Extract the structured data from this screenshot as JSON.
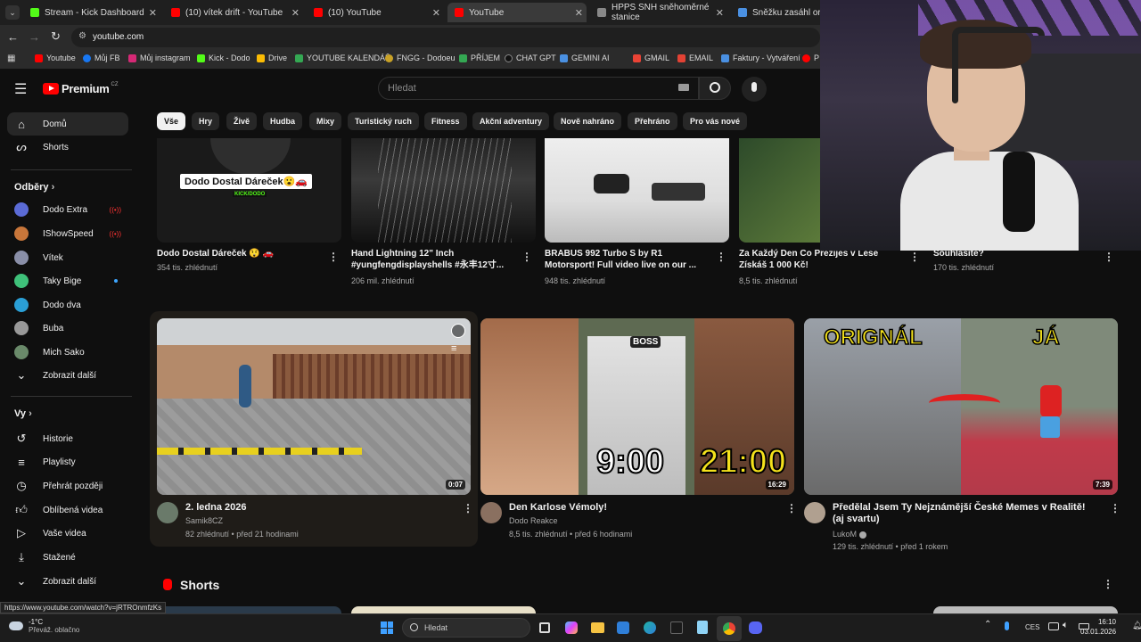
{
  "browser": {
    "tabs": [
      {
        "label": "Stream - Kick Dashboard",
        "color": "#53fc18"
      },
      {
        "label": "(10) vítek drift - YouTube",
        "color": "#ff0000"
      },
      {
        "label": "(10) YouTube",
        "color": "#ff0000"
      },
      {
        "label": "YouTube",
        "color": "#ff0000"
      },
      {
        "label": "HPPS SNH sněhoměrné stanice",
        "color": "#888888"
      },
      {
        "label": "Sněžku zasáhl orkán, vi",
        "color": "#4a90e2"
      }
    ],
    "url": "youtube.com",
    "bookmarks": [
      "Youtube",
      "Můj FB",
      "Můj instagram",
      "Kick - Dodo",
      "Drive",
      "YOUTUBE KALENDÁŘ",
      "FNGG - Dodoeu",
      "PŘÍJEM",
      "CHAT GPT",
      "GEMINI AI",
      "GMAIL",
      "EMAIL",
      "Faktury - Vytváření",
      "P"
    ]
  },
  "yt": {
    "logo": "Premium",
    "region": "CZ",
    "search_placeholder": "Hledat"
  },
  "sidebar": {
    "home": "Domů",
    "shorts": "Shorts",
    "subs_header": "Odběry",
    "channels": [
      "Dodo Extra",
      "IShowSpeed",
      "Vítek",
      "Taky Bige",
      "Dodo dva",
      "Buba",
      "Mich Sako"
    ],
    "show_more1": "Zobrazit další",
    "you_header": "Vy",
    "you_items": [
      "Historie",
      "Playlisty",
      "Přehrát později",
      "Oblíbená videa",
      "Vaše videa",
      "Stažené"
    ],
    "show_more2": "Zobrazit další"
  },
  "chips": [
    "Vše",
    "Hry",
    "Živě",
    "Hudba",
    "Mixy",
    "Turistický ruch",
    "Fitness",
    "Akční adventury",
    "Nově nahráno",
    "Přehráno",
    "Pro vás nové"
  ],
  "row1": [
    {
      "title": "Dodo Dostal Dáreček 😲 🚗",
      "meta": "354 tis. zhlédnutí",
      "thumb_text": "Dodo Dostal Dáreček😮🚗",
      "thumb_sub": "KICK/DODO"
    },
    {
      "title": "Hand Lightning 12\" Inch #yungfengdisplayshells #永丰12寸...",
      "meta": "206 mil. zhlédnutí"
    },
    {
      "title": "BRABUS 992 Turbo S by R1 Motorsport! Full video live on our ...",
      "meta": "948 tis. zhlédnutí"
    },
    {
      "title": "Za Každý Den Co Prezíjes v Lese Získáš 1 000 Kč!",
      "meta": "8,5 tis. zhlédnutí"
    },
    {
      "title": "Souhlasíte?",
      "meta": "170 tis. zhlédnutí"
    }
  ],
  "row2": [
    {
      "title": "2. ledna 2026",
      "channel": "Samik8CZ",
      "meta": "82 zhlédnutí • před 21 hodinami",
      "duration": "0:07"
    },
    {
      "title": "Den Karlose Vémoly!",
      "channel": "Dodo Reakce",
      "meta": "8,5 tis. zhlédnutí • před 6 hodinami",
      "duration": "16:29",
      "thumb_left": "9:00",
      "thumb_right": "21:00",
      "thumb_badge": "BOSS"
    },
    {
      "title": "Předělal Jsem Ty Nejznámější České Memes v Realitě! (aj svartu)",
      "channel": "LukoM",
      "meta": "129 tis. zhlédnutí • před 1 rokem",
      "duration": "7:39",
      "thumb_left": "ORIGNÁL",
      "thumb_right": "JÁ"
    }
  ],
  "shorts_label": "Shorts",
  "status_url": "https://www.youtube.com/watch?v=jRTROnmfzKs",
  "taskbar": {
    "weather_temp": "-1°C",
    "weather_desc": "Převáž. oblačno",
    "search": "Hledat",
    "lang": "CES",
    "time": "16:10",
    "date": "03.01.2026"
  }
}
